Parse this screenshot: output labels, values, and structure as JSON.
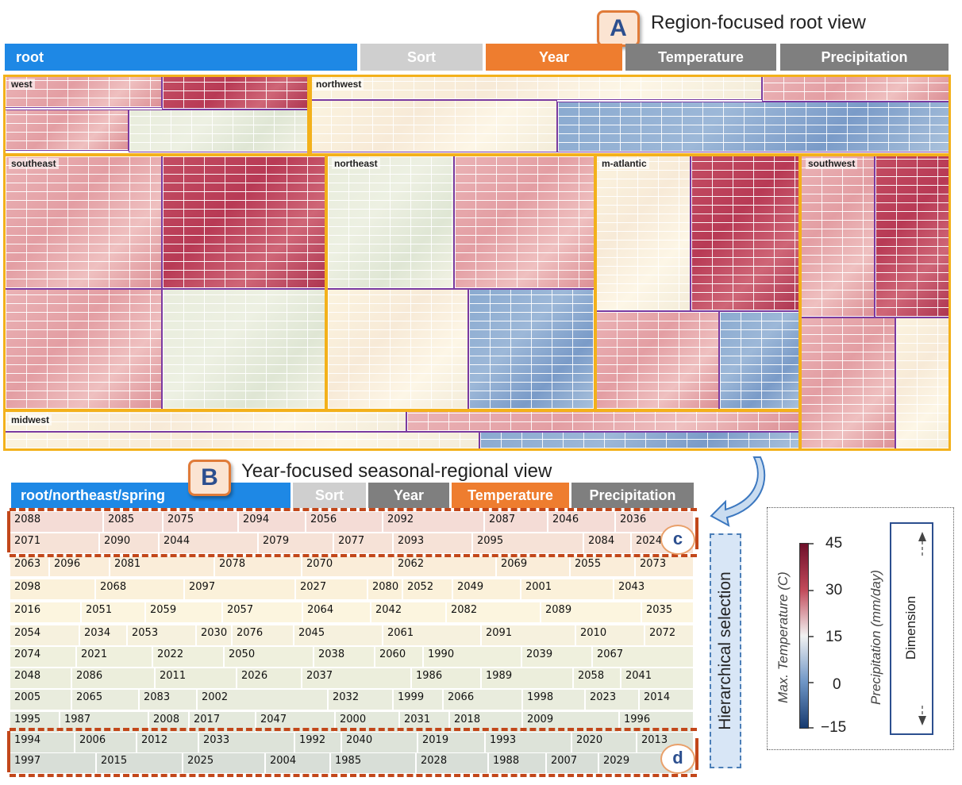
{
  "panel_a": {
    "badge": "A",
    "caption": "Region-focused root view",
    "toolbar": {
      "root": "root",
      "sort": "Sort",
      "year": "Year",
      "temperature": "Temperature",
      "precipitation": "Precipitation"
    },
    "regions": [
      "west",
      "northwest",
      "southeast",
      "northeast",
      "m-atlantic",
      "southwest",
      "midwest"
    ]
  },
  "panel_b": {
    "badge": "B",
    "caption": "Year-focused seasonal-regional view",
    "toolbar": {
      "path": "root/northeast/spring",
      "sort": "Sort",
      "year": "Year",
      "temperature": "Temperature",
      "precipitation": "Precipitation"
    },
    "circle_c": "c",
    "circle_d": "d",
    "rows": [
      [
        "2088",
        "2085",
        "2075",
        "2094",
        "2056",
        "2092",
        "2087",
        "2046",
        "2036"
      ],
      [
        "2071",
        "2090",
        "2044",
        "2079",
        "2077",
        "2093",
        "2095",
        "2084",
        "2024"
      ],
      [
        "2063",
        "2096",
        "2081",
        "2078",
        "2070",
        "2062",
        "2069",
        "2055",
        "2073"
      ],
      [
        "2098",
        "2068",
        "2097",
        "2027",
        "2080",
        "2052",
        "2049",
        "2001",
        "2043"
      ],
      [
        "2016",
        "2051",
        "2059",
        "2057",
        "2064",
        "2042",
        "2082",
        "2089",
        "2035"
      ],
      [
        "2054",
        "2034",
        "2053",
        "2030",
        "2076",
        "2045",
        "2061",
        "2091",
        "2010",
        "2072"
      ],
      [
        "2074",
        "2021",
        "2022",
        "2050",
        "2038",
        "2060",
        "1990",
        "2039",
        "2067"
      ],
      [
        "2048",
        "2086",
        "2011",
        "2026",
        "2037",
        "1986",
        "1989",
        "2058",
        "2041"
      ],
      [
        "2005",
        "2065",
        "2083",
        "2002",
        "2032",
        "1999",
        "2066",
        "1998",
        "2023",
        "2014"
      ],
      [
        "1995",
        "1987",
        "2008",
        "2017",
        "2047",
        "2000",
        "2031",
        "2018",
        "2009",
        "1996"
      ],
      [
        "1994",
        "2006",
        "2012",
        "2033",
        "1992",
        "2040",
        "2019",
        "1993",
        "2020",
        "2013"
      ],
      [
        "1997",
        "2015",
        "2025",
        "2004",
        "1985",
        "2028",
        "1988",
        "2007",
        "2029"
      ]
    ]
  },
  "hierarchical_selection": "Hierarchical selection",
  "legend": {
    "temp_label": "Max. Temperature (C)",
    "ticks": [
      "45",
      "30",
      "15",
      "0",
      "−15"
    ],
    "precip_label": "Precipitation (mm/day)",
    "dimension_label": "Dimension"
  },
  "colors": {
    "blue": "#1e88e5",
    "orange": "#ee7d2f",
    "gray": "#7f7f7f",
    "lightgray": "#cfcfcf",
    "warm": "#b2384d",
    "cool": "#4c7fb8"
  }
}
